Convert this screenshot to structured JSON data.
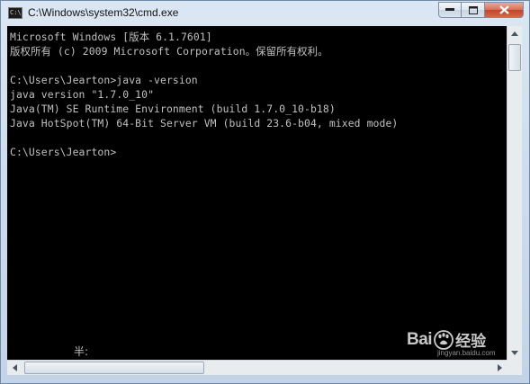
{
  "window": {
    "title": "C:\\Windows\\system32\\cmd.exe",
    "icon_label": "C:\\"
  },
  "console": {
    "lines": [
      "Microsoft Windows [版本 6.1.7601]",
      "版权所有 (c) 2009 Microsoft Corporation。保留所有权利。",
      "",
      "C:\\Users\\Jearton>java -version",
      "java version \"1.7.0_10\"",
      "Java(TM) SE Runtime Environment (build 1.7.0_10-b18)",
      "Java HotSpot(TM) 64-Bit Server VM (build 23.6-b04, mixed mode)",
      "",
      "C:\\Users\\Jearton>"
    ],
    "ime_status": "半:",
    "text_color": "#c0c0c0",
    "background_color": "#000000"
  },
  "watermark": {
    "brand": "Bai",
    "brand_suffix": "经验",
    "url": "jingyan.baidu.com"
  },
  "colors": {
    "title_bar": "#cfdeee",
    "close_button": "#c2452b"
  },
  "icons": [
    "cmd-app-icon",
    "minimize-icon",
    "maximize-icon",
    "close-icon",
    "scroll-up-icon",
    "scroll-down-icon",
    "scroll-left-icon",
    "scroll-right-icon",
    "baidu-paw-icon"
  ]
}
